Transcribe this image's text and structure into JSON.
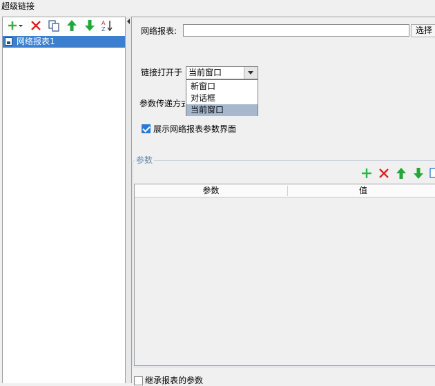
{
  "window": {
    "title": "超级链接"
  },
  "left_toolbar": {
    "icons": [
      "add-dropdown-icon",
      "delete-icon",
      "copy-icon",
      "move-up-icon",
      "move-down-icon",
      "sort-az-icon"
    ]
  },
  "tree": {
    "items": [
      {
        "label": "网络报表1",
        "selected": true
      }
    ]
  },
  "form": {
    "report_label": "网络报表:",
    "report_value": "",
    "select_button": "选择",
    "open_in_label": "链接打开于",
    "open_in_value": "当前窗口",
    "open_in_options": [
      "新窗口",
      "对话框",
      "当前窗口"
    ],
    "param_mode_label": "参数传递方式",
    "show_params_label": "展示网络报表参数界面",
    "show_params_checked": true
  },
  "params": {
    "group_title": "参数",
    "columns": [
      "参数",
      "值"
    ],
    "rows": []
  },
  "inherit": {
    "label": "继承报表的参数",
    "checked": false
  },
  "colors": {
    "selection": "#3c7fcf",
    "add": "#2db34a",
    "delete": "#e02020",
    "arrow": "#22a83a",
    "fieldset_title": "#6a8ab0"
  }
}
